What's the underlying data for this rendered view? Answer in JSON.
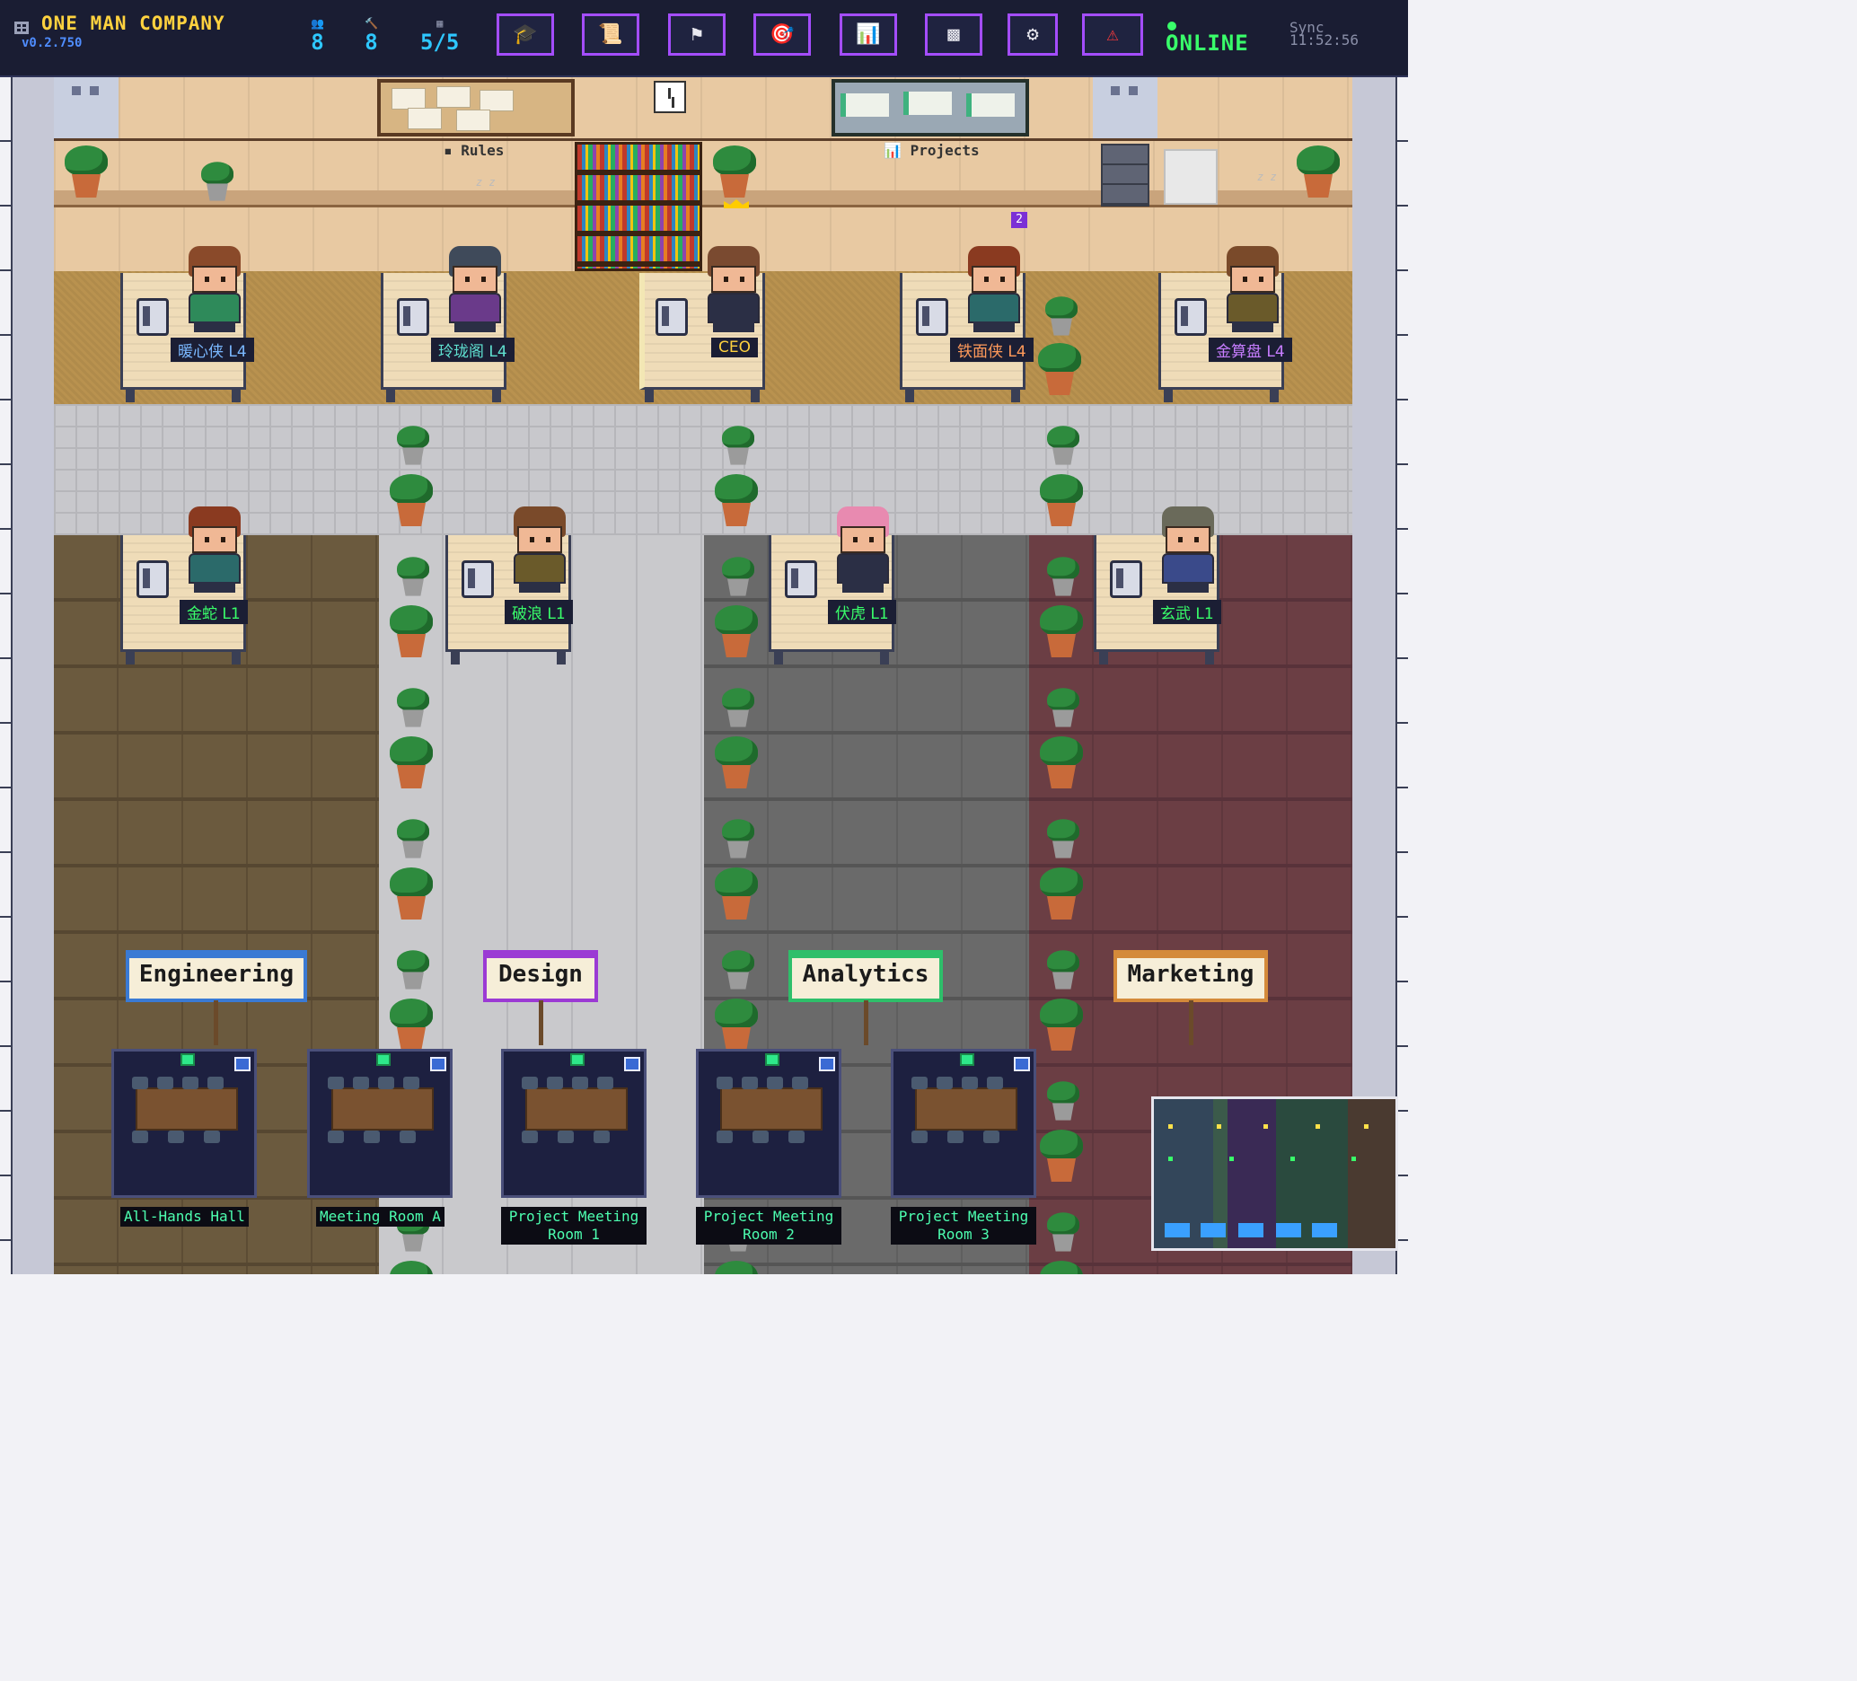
{
  "app": {
    "title": "ONE MAN COMPANY",
    "version": "v0.2.750"
  },
  "stats": [
    {
      "icon": "people-icon",
      "glyph": "👥",
      "value": "8"
    },
    {
      "icon": "tools-icon",
      "glyph": "🔨",
      "value": "8"
    },
    {
      "icon": "building-icon",
      "glyph": "▦",
      "value": "5/5"
    }
  ],
  "toolbar": [
    {
      "icon": "graduation-cap-icon",
      "glyph": "🎓"
    },
    {
      "icon": "scroll-icon",
      "glyph": "📜"
    },
    {
      "icon": "flag-icon",
      "glyph": "⚑"
    },
    {
      "icon": "target-icon",
      "glyph": "🎯"
    },
    {
      "icon": "bar-chart-icon",
      "glyph": "📊"
    },
    {
      "icon": "grid-icon",
      "glyph": "▩"
    },
    {
      "icon": "gear-icon",
      "glyph": "⚙"
    },
    {
      "icon": "warning-icon",
      "glyph": "⚠"
    }
  ],
  "status": {
    "online": "ONLINE",
    "sync_label": "Sync",
    "time": "11:52:56"
  },
  "boards": {
    "rules": "Rules",
    "projects": "Projects"
  },
  "badge": "2",
  "employees_top": [
    {
      "name": "暖心侠 L4",
      "color": "#7ab8ff"
    },
    {
      "name": "玲珑阁 L4",
      "color": "#5fe0d0"
    },
    {
      "name": "CEO",
      "color": "#ffd23f"
    },
    {
      "name": "铁面侠 L4",
      "color": "#ff9a5a"
    },
    {
      "name": "金算盘 L4",
      "color": "#c77dff"
    }
  ],
  "employees_bottom": [
    {
      "name": "金蛇 L1",
      "color": "#39ff6a"
    },
    {
      "name": "破浪 L1",
      "color": "#39ff6a"
    },
    {
      "name": "伏虎 L1",
      "color": "#39ff6a"
    },
    {
      "name": "玄武 L1",
      "color": "#39ff6a"
    }
  ],
  "departments": [
    {
      "label": "Engineering",
      "color": "#3a7ad4"
    },
    {
      "label": "Design",
      "color": "#9b3ad4"
    },
    {
      "label": "Analytics",
      "color": "#2ebf6a"
    },
    {
      "label": "Marketing",
      "color": "#d48a3a"
    }
  ],
  "rooms": [
    {
      "label": "All-Hands Hall"
    },
    {
      "label": "Meeting Room A"
    },
    {
      "label": "Project Meeting Room 1"
    },
    {
      "label": "Project Meeting Room 2"
    },
    {
      "label": "Project Meeting Room 3"
    }
  ]
}
